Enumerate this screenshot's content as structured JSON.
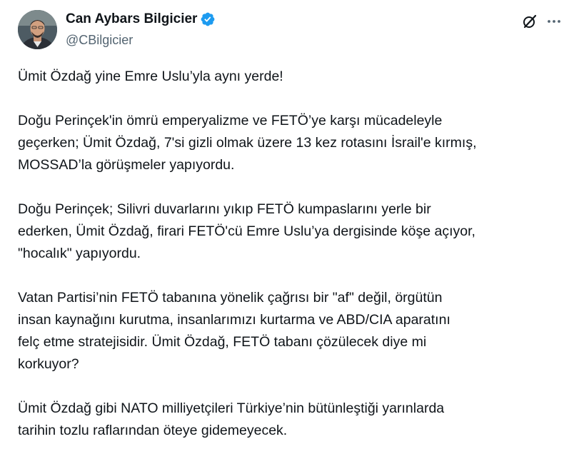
{
  "author": {
    "display_name": "Can Aybars Bilgicier",
    "handle": "@CBilgicier",
    "verified": true
  },
  "icons": {
    "verified": "verified-badge-icon",
    "grok": "grok-icon",
    "more": "more-options-icon"
  },
  "colors": {
    "verified_badge": "#1d9bf0",
    "text": "#0f1419",
    "secondary_text": "#536471"
  },
  "tweet": {
    "paragraphs": [
      {
        "lines": [
          "Ümit Özdağ yine Emre Uslu’yla aynı yerde!"
        ]
      },
      {
        "lines": [
          "Doğu Perinçek'in ömrü emperyalizme ve FETÖ’ye karşı mücadeleyle",
          "geçerken; Ümit Özdağ, 7'si gizli olmak üzere 13 kez rotasını İsrail'e kırmış,",
          "MOSSAD’la görüşmeler yapıyordu."
        ]
      },
      {
        "lines": [
          "Doğu Perinçek; Silivri duvarlarını yıkıp FETÖ kumpaslarını yerle bir",
          "ederken, Ümit Özdağ, firari FETÖ'cü Emre Uslu’ya dergisinde köşe açıyor,",
          "\"hocalık\" yapıyordu."
        ]
      },
      {
        "lines": [
          "Vatan Partisi’nin FETÖ tabanına yönelik çağrısı bir \"af\" değil, örgütün",
          "insan kaynağını kurutma, insanlarımızı kurtarma ve ABD/CIA aparatını",
          "felç etme stratejisidir. Ümit Özdağ, FETÖ tabanı çözülecek diye mi",
          "korkuyor?"
        ]
      },
      {
        "lines": [
          "Ümit Özdağ gibi NATO milliyetçileri Türkiye’nin bütünleştiği yarınlarda",
          "tarihin tozlu raflarından öteye gidemeyecek."
        ]
      }
    ]
  }
}
